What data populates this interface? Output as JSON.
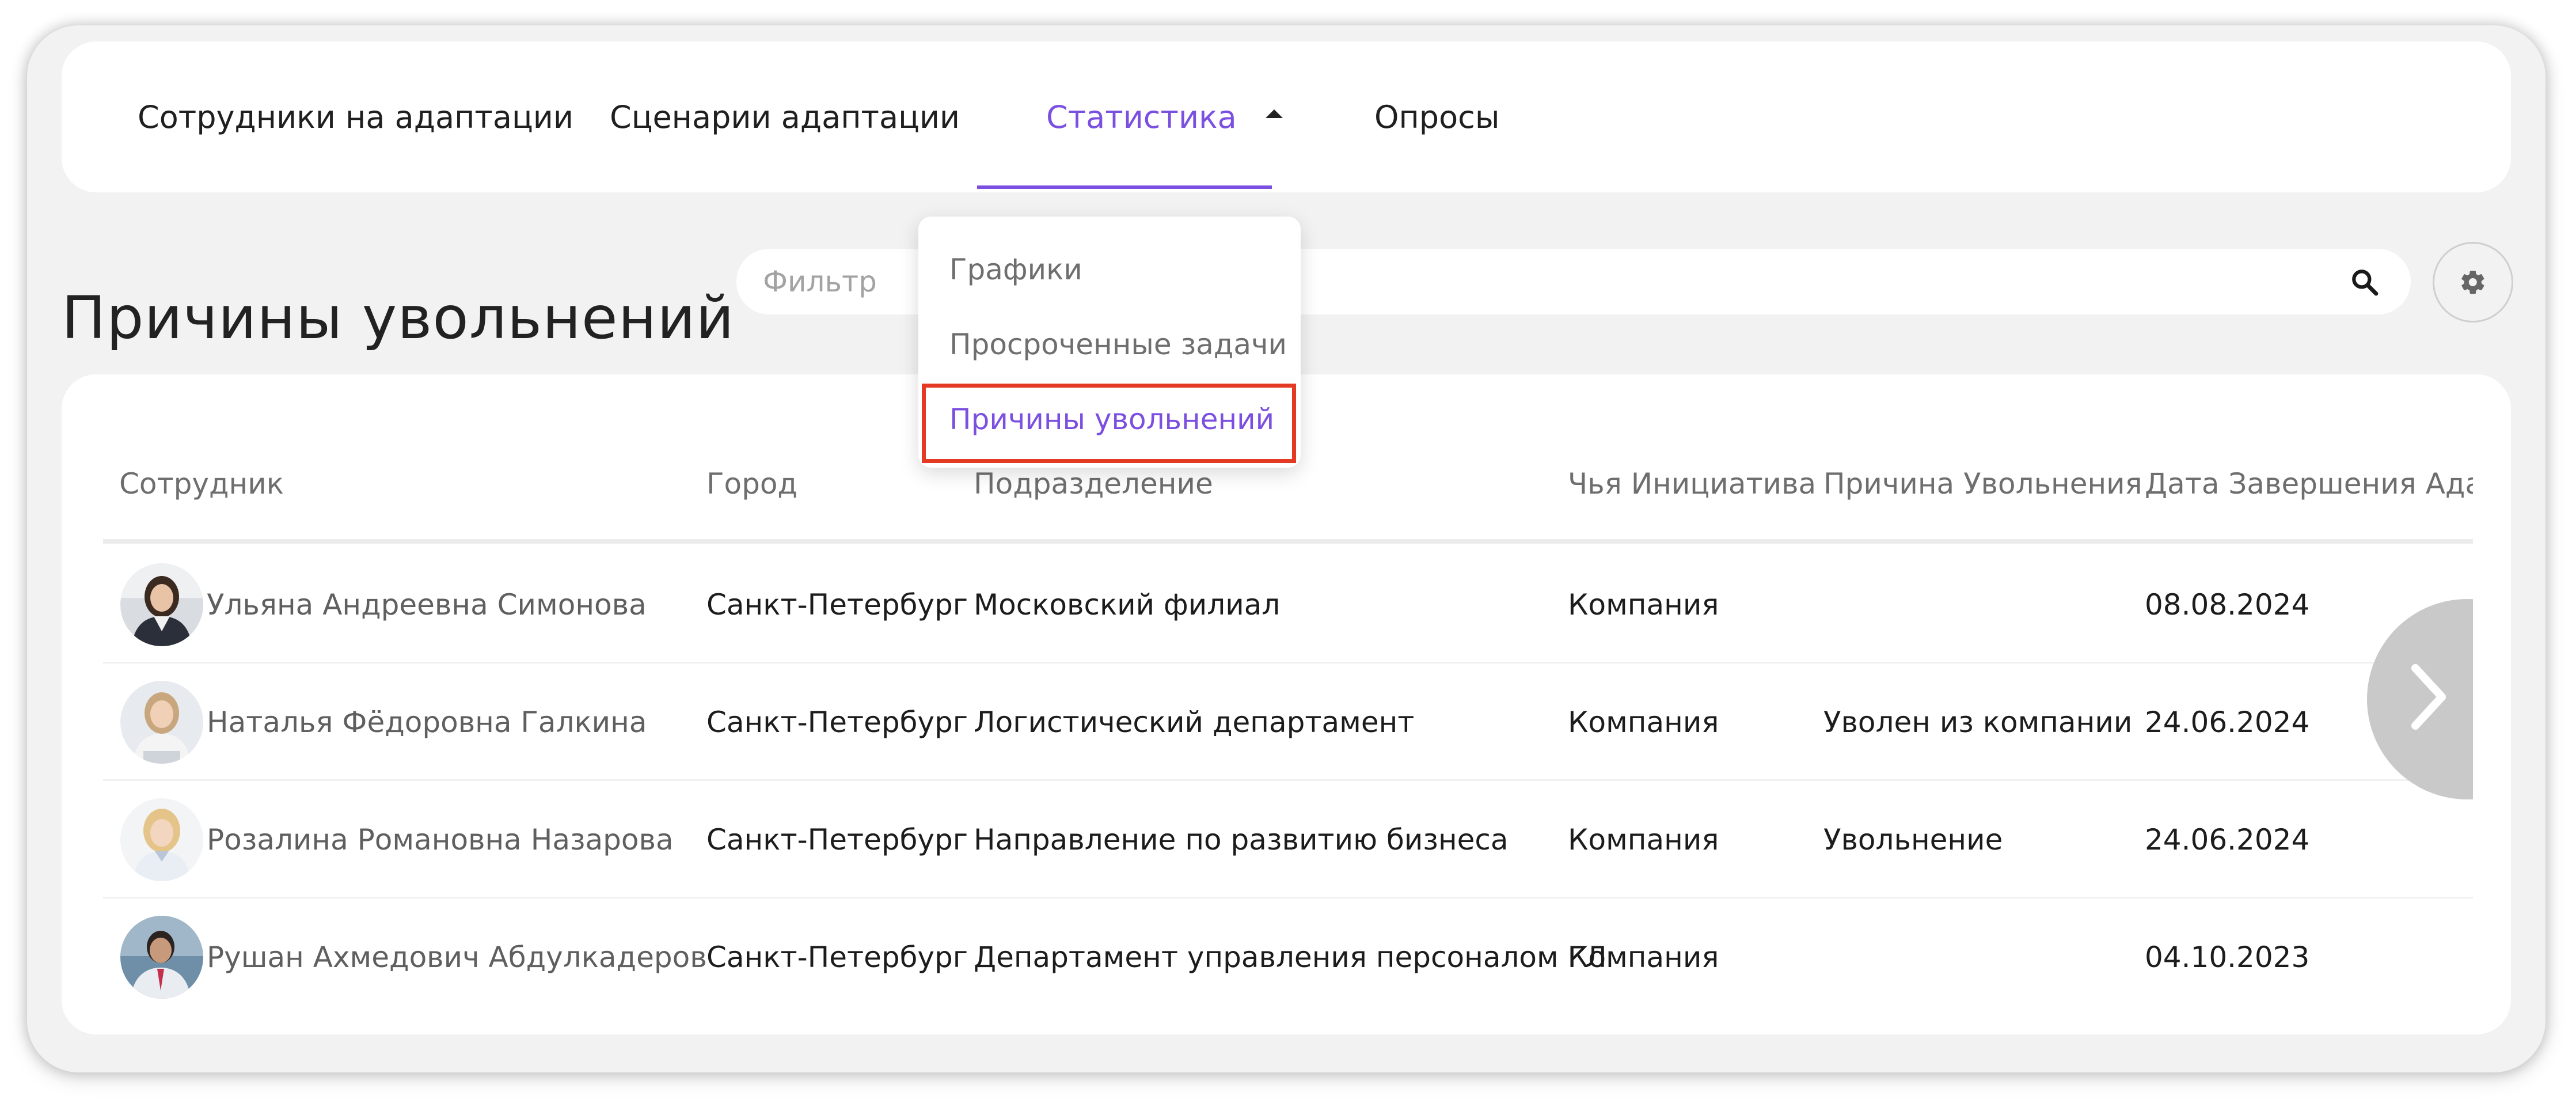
{
  "nav": {
    "tabs": [
      {
        "label": "Сотрудники на адаптации"
      },
      {
        "label": "Сценарии адаптации"
      },
      {
        "label": "Статистика"
      },
      {
        "label": "Опросы"
      }
    ],
    "active_tab": "Статистика"
  },
  "dropdown": {
    "items": [
      {
        "label": "Графики"
      },
      {
        "label": "Просроченные задачи"
      },
      {
        "label": "Причины увольнений"
      }
    ],
    "selected": "Причины увольнений"
  },
  "page": {
    "title": "Причины увольнений"
  },
  "filter": {
    "placeholder": "Фильтр",
    "value": ""
  },
  "icons": {
    "search": "search-icon",
    "settings": "gear-icon",
    "next": "chevron-right-icon",
    "caret": "caret-up-icon"
  },
  "table": {
    "columns": [
      "Сотрудник",
      "Город",
      "Подразделение",
      "Чья Инициатива",
      "Причина Увольнения",
      "Дата Завершения Адапт"
    ],
    "rows": [
      {
        "employee": "Ульяна Андреевна Симонова",
        "city": "Санкт-Петербург",
        "department": "Московский филиал",
        "initiative": "Компания",
        "reason": "",
        "end_date": "08.08.2024"
      },
      {
        "employee": "Наталья Фёдоровна Галкина",
        "city": "Санкт-Петербург",
        "department": "Логистический департамент",
        "initiative": "Компания",
        "reason": "Уволен из компании",
        "end_date": "24.06.2024"
      },
      {
        "employee": "Розалина Романовна Назарова",
        "city": "Санкт-Петербург",
        "department": "Направление по развитию бизнеса",
        "initiative": "Компания",
        "reason": "Увольнение",
        "end_date": "24.06.2024"
      },
      {
        "employee": "Рушан Ахмедович Абдулкадеров",
        "city": "Санкт-Петербург",
        "department": "Департамент управления персоналом ГЛ",
        "initiative": "Компания",
        "reason": "",
        "end_date": "04.10.2023"
      }
    ]
  },
  "colors": {
    "accent": "#7b4fe0",
    "highlight": "#e43a24",
    "background": "#f2f2f2"
  }
}
